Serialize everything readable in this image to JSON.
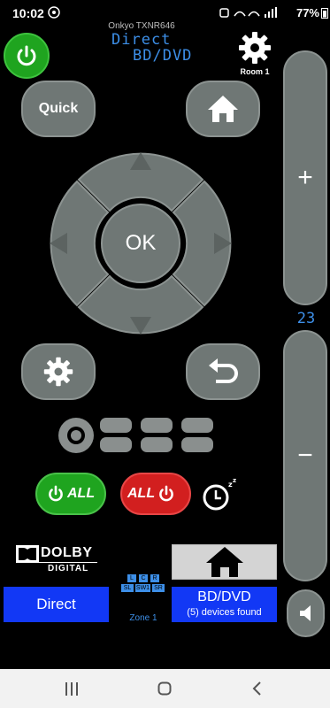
{
  "status_bar": {
    "time": "10:02",
    "battery": "77%"
  },
  "device": {
    "model": "Onkyo TXNR646",
    "mode": "Direct",
    "input": "BD/DVD"
  },
  "room": {
    "label": "Room 1"
  },
  "buttons": {
    "quick": "Quick",
    "ok": "OK",
    "all_on": "ALL",
    "all_off": "ALL"
  },
  "volume": {
    "plus": "+",
    "minus": "−",
    "level": "23"
  },
  "dolby": {
    "brand": "DOLBY",
    "sub": "DIGITAL"
  },
  "speakers": {
    "top": [
      "L",
      "C",
      "R"
    ],
    "bottom": [
      "SL",
      "SW1",
      "SR"
    ]
  },
  "zone": {
    "label": "Zone 1"
  },
  "bottom": {
    "listening_mode": "Direct",
    "input_name": "BD/DVD",
    "devices_found": "(5) devices found"
  },
  "colors": {
    "accent_blue": "#1238f5",
    "power_green": "#1fa41f",
    "all_off_red": "#d21f1f",
    "lcd_blue": "#3d8fe8"
  }
}
